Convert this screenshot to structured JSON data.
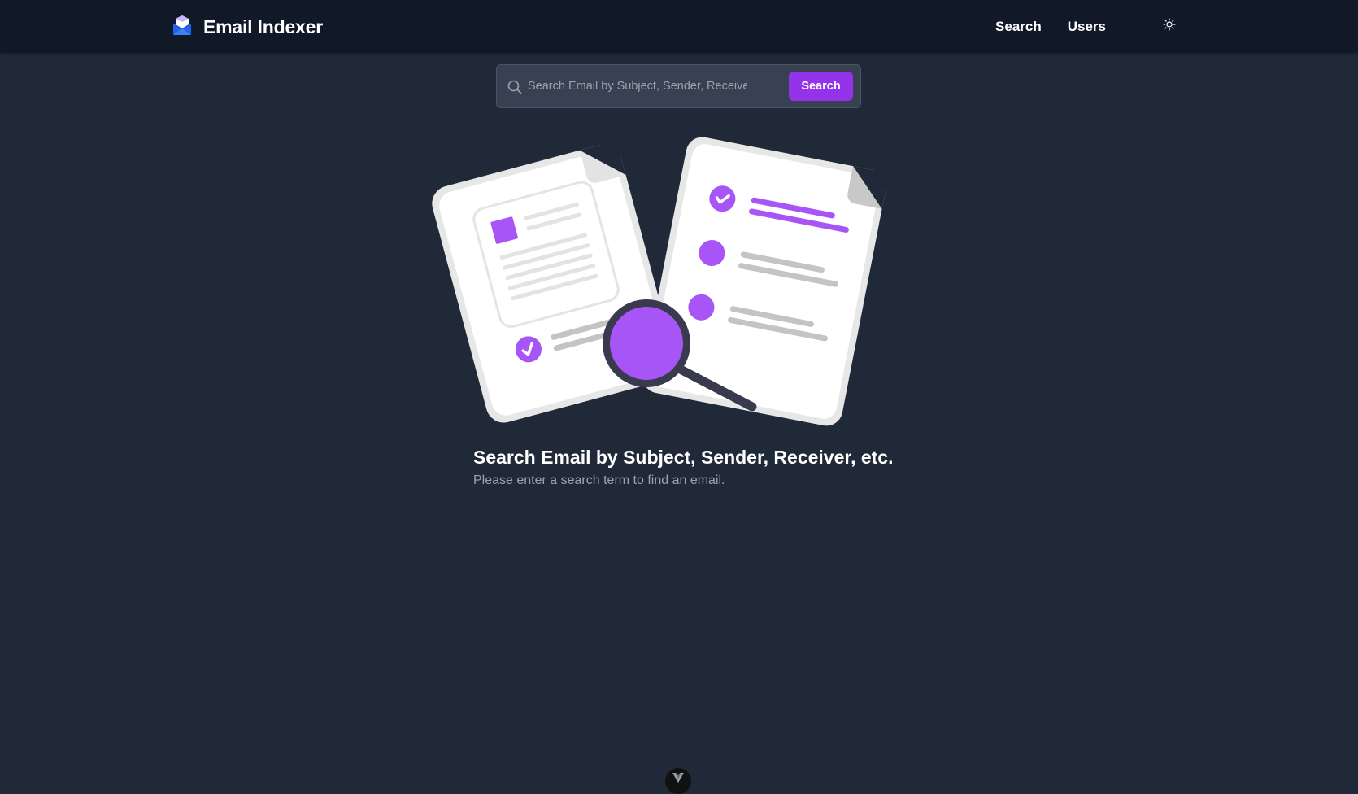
{
  "app": {
    "title": "Email Indexer",
    "logo_icon": "mail-open-icon",
    "accent_color": "#9333ea"
  },
  "nav": {
    "items": [
      {
        "label": "Search",
        "name": "nav-search-link"
      },
      {
        "label": "Users",
        "name": "nav-users-link"
      }
    ],
    "theme_toggle_icon": "sun-icon"
  },
  "search": {
    "placeholder": "Search Email by Subject, Sender, Receiver, etc.",
    "value": "",
    "button_label": "Search",
    "icon": "search-icon"
  },
  "empty_state": {
    "illustration_icon": "document-search-illustration",
    "title": "Search Email by Subject, Sender, Receiver, etc.",
    "subtitle": "Please enter a search term to find an email."
  },
  "devtools": {
    "icon": "vue-logo-icon"
  }
}
